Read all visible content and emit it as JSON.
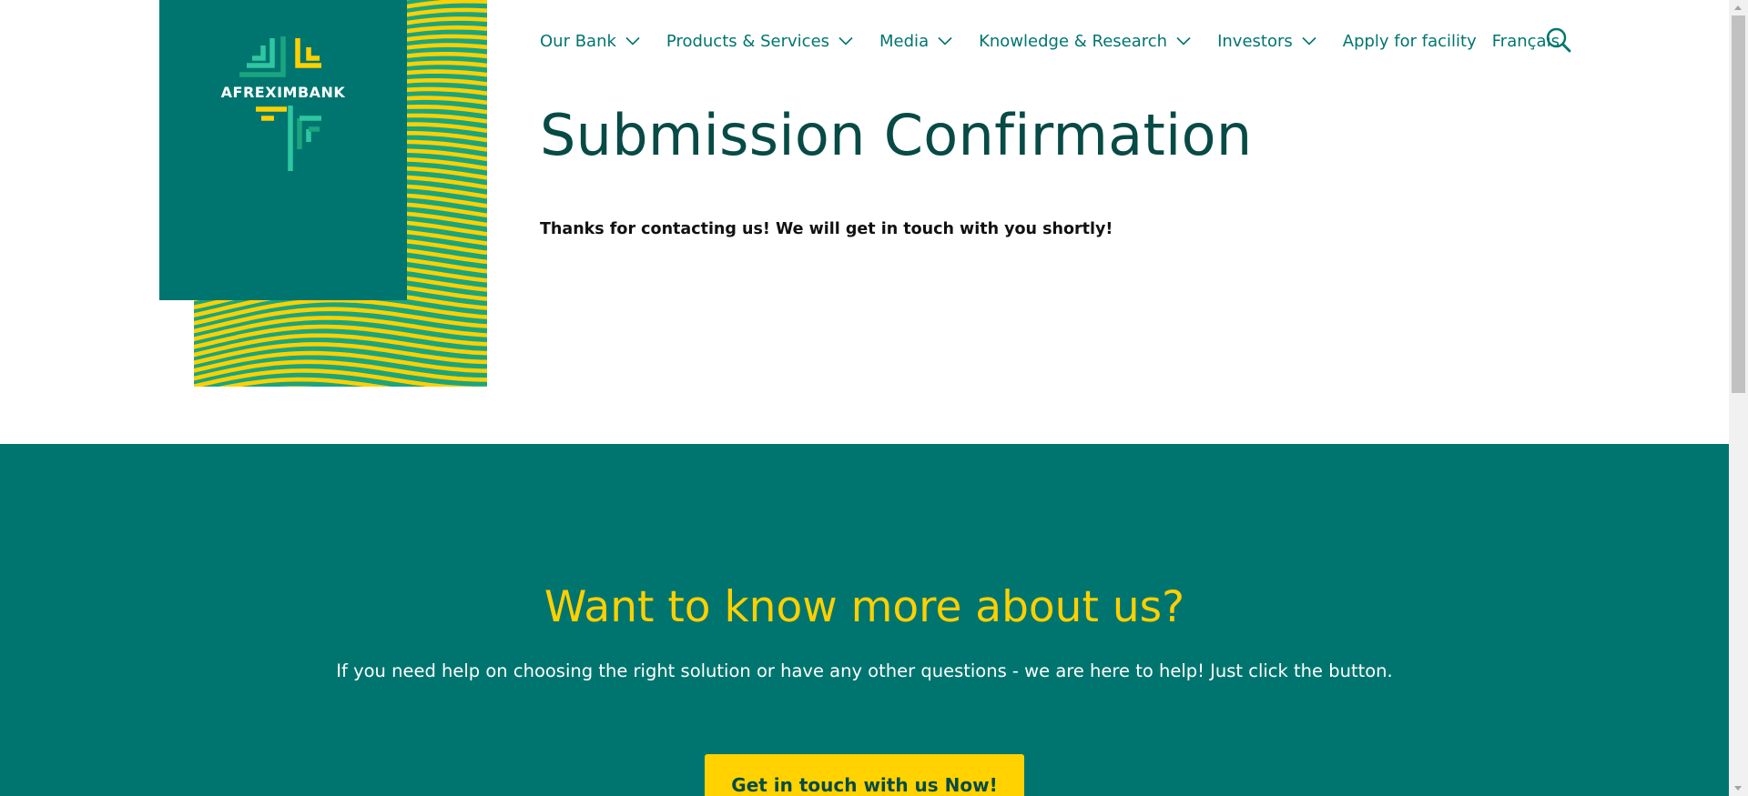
{
  "brand": {
    "name": "AFREXIMBANK",
    "colors": {
      "teal": "#00756f",
      "dark_teal": "#074a46",
      "yellow": "#fed000",
      "green": "#1aa57f"
    }
  },
  "nav": {
    "items": [
      {
        "label": "Our Bank",
        "has_dropdown": true
      },
      {
        "label": "Products & Services",
        "has_dropdown": true
      },
      {
        "label": "Media",
        "has_dropdown": true
      },
      {
        "label": "Knowledge & Research",
        "has_dropdown": true
      },
      {
        "label": "Investors",
        "has_dropdown": true
      },
      {
        "label": "Apply for facility",
        "has_dropdown": false
      },
      {
        "label": "Français",
        "has_dropdown": false
      }
    ],
    "search_icon": "search-icon"
  },
  "main": {
    "title": "Submission Confirmation",
    "message": "Thanks for contacting us! We will get in touch with you shortly!"
  },
  "cta": {
    "heading": "Want to know more about us?",
    "text": "If you need help on choosing the right solution or have any other questions - we are here to help! Just click the button.",
    "button_label": "Get in touch with us Now!"
  }
}
